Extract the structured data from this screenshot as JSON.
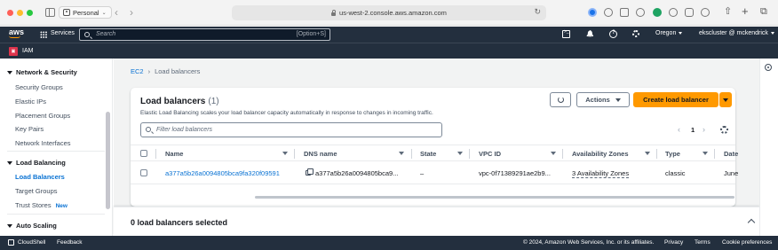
{
  "browser": {
    "profile": "Personal",
    "url": "us-west-2.console.aws.amazon.com"
  },
  "aws_nav": {
    "logo": "aws",
    "services": "Services",
    "search_placeholder": "Search",
    "search_shortcut": "[Option+S]",
    "region": "Oregon",
    "user": "ekscluster @ mckendrick"
  },
  "favorites": {
    "iam_label": "IAM"
  },
  "sidebar": {
    "sections": [
      {
        "title": "Network & Security",
        "items": [
          "Security Groups",
          "Elastic IPs",
          "Placement Groups",
          "Key Pairs",
          "Network Interfaces"
        ]
      },
      {
        "title": "Load Balancing",
        "items": [
          "Load Balancers",
          "Target Groups",
          "Trust Stores"
        ]
      },
      {
        "title": "Auto Scaling",
        "items": []
      }
    ],
    "new_badge": "New",
    "active_item": "Load Balancers"
  },
  "breadcrumb": {
    "root": "EC2",
    "current": "Load balancers"
  },
  "panel": {
    "title": "Load balancers",
    "count": "(1)",
    "description": "Elastic Load Balancing scales your load balancer capacity automatically in response to changes in incoming traffic.",
    "actions_label": "Actions",
    "create_label": "Create load balancer",
    "filter_placeholder": "Filter load balancers",
    "page": "1"
  },
  "table": {
    "columns": [
      "Name",
      "DNS name",
      "State",
      "VPC ID",
      "Availability Zones",
      "Type",
      "Date"
    ],
    "rows": [
      {
        "name": "a377a5b26a0094805bca9fa320f09591",
        "dns": "a377a5b26a0094805bca9...",
        "state": "–",
        "vpc": "vpc-0f71389291ae2b9...",
        "azs": "3 Availability Zones",
        "type": "classic",
        "date": "June"
      }
    ]
  },
  "split_panel": {
    "title": "0 load balancers selected"
  },
  "footer": {
    "cloudshell": "CloudShell",
    "feedback": "Feedback",
    "copyright": "© 2024, Amazon Web Services, Inc. or its affiliates.",
    "privacy": "Privacy",
    "terms": "Terms",
    "cookies": "Cookie preferences"
  },
  "colors": {
    "aws_nav": "#232f3e",
    "primary_button": "#ff9900",
    "link": "#0972d3",
    "iam_badge": "#dd344c"
  }
}
